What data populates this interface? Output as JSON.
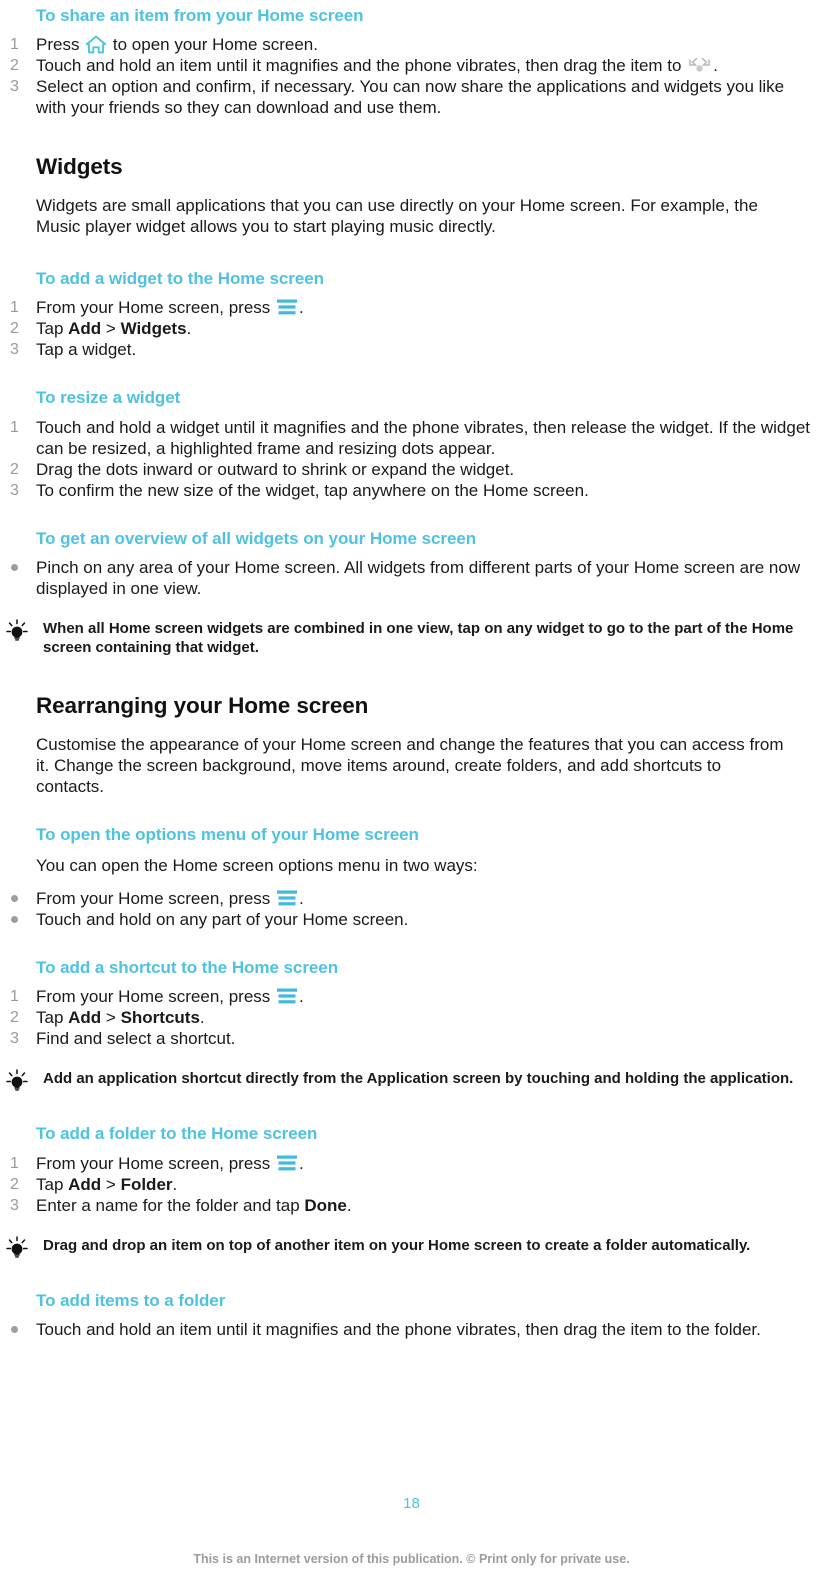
{
  "colors": {
    "accent": "#4ec2e0",
    "body_text": "#1a1a1a",
    "marker_gray": "#9a9a9a",
    "footer_gray": "#9c9c9c"
  },
  "sections": {
    "share_item": {
      "heading": "To share an item from your Home screen",
      "steps": [
        {
          "num": "1",
          "pre": "Press ",
          "icon": "home-icon",
          "post": " to open your Home screen."
        },
        {
          "num": "2",
          "pre": "Touch and hold an item until it magnifies and the phone vibrates, then drag the item to ",
          "icon": "share-icon",
          "post": "."
        },
        {
          "num": "3",
          "text": "Select an option and confirm, if necessary. You can now share the applications and widgets you like with your friends so they can download and use them."
        }
      ]
    },
    "widgets": {
      "heading": "Widgets",
      "intro": "Widgets are small applications that you can use directly on your Home screen. For example, the Music player widget allows you to start playing music directly.",
      "add_widget": {
        "heading": "To add a widget to the Home screen",
        "steps": [
          {
            "num": "1",
            "pre": "From your Home screen, press ",
            "icon": "menu-icon",
            "post": "."
          },
          {
            "num": "2",
            "pre": "Tap ",
            "bold1": "Add",
            "sep": " > ",
            "bold2": "Widgets",
            "post": "."
          },
          {
            "num": "3",
            "text": "Tap a widget."
          }
        ]
      },
      "resize_widget": {
        "heading": "To resize a widget",
        "steps": [
          {
            "num": "1",
            "text": "Touch and hold a widget until it magnifies and the phone vibrates, then release the widget. If the widget can be resized, a highlighted frame and resizing dots appear."
          },
          {
            "num": "2",
            "text": "Drag the dots inward or outward to shrink or expand the widget."
          },
          {
            "num": "3",
            "text": "To confirm the new size of the widget, tap anywhere on the Home screen."
          }
        ]
      },
      "overview_widgets": {
        "heading": "To get an overview of all widgets on your Home screen",
        "bullets": [
          {
            "text": "Pinch on any area of your Home screen. All widgets from different parts of your Home screen are now displayed in one view."
          }
        ],
        "tip": "When all Home screen widgets are combined in one view, tap on any widget to go to the part of the Home screen containing that widget."
      }
    },
    "rearranging": {
      "heading": "Rearranging your Home screen",
      "intro": "Customise the appearance of your Home screen and change the features that you can access from it. Change the screen background, move items around, create folders, and add shortcuts to contacts.",
      "options_menu": {
        "heading": "To open the options menu of your Home screen",
        "intro": "You can open the Home screen options menu in two ways:",
        "bullets": [
          {
            "pre": "From your Home screen, press ",
            "icon": "menu-icon",
            "post": "."
          },
          {
            "text": "Touch and hold on any part of your Home screen."
          }
        ]
      },
      "add_shortcut": {
        "heading": "To add a shortcut to the Home screen",
        "steps": [
          {
            "num": "1",
            "pre": "From your Home screen, press ",
            "icon": "menu-icon",
            "post": "."
          },
          {
            "num": "2",
            "pre": "Tap ",
            "bold1": "Add",
            "sep": " > ",
            "bold2": "Shortcuts",
            "post": "."
          },
          {
            "num": "3",
            "text": "Find and select a shortcut."
          }
        ],
        "tip": "Add an application shortcut directly from the Application screen by touching and holding the application."
      },
      "add_folder": {
        "heading": "To add a folder to the Home screen",
        "steps": [
          {
            "num": "1",
            "pre": "From your Home screen, press ",
            "icon": "menu-icon",
            "post": "."
          },
          {
            "num": "2",
            "pre": "Tap ",
            "bold1": "Add",
            "sep": " > ",
            "bold2": "Folder",
            "post": "."
          },
          {
            "num": "3",
            "pre": "Enter a name for the folder and tap ",
            "bold1": "Done",
            "post": "."
          }
        ],
        "tip": "Drag and drop an item on top of another item on your Home screen to create a folder automatically."
      },
      "add_items_folder": {
        "heading": "To add items to a folder",
        "bullets": [
          {
            "text": "Touch and hold an item until it magnifies and the phone vibrates, then drag the item to the folder."
          }
        ]
      }
    }
  },
  "footer": {
    "page_number": "18",
    "note": "This is an Internet version of this publication. © Print only for private use."
  }
}
